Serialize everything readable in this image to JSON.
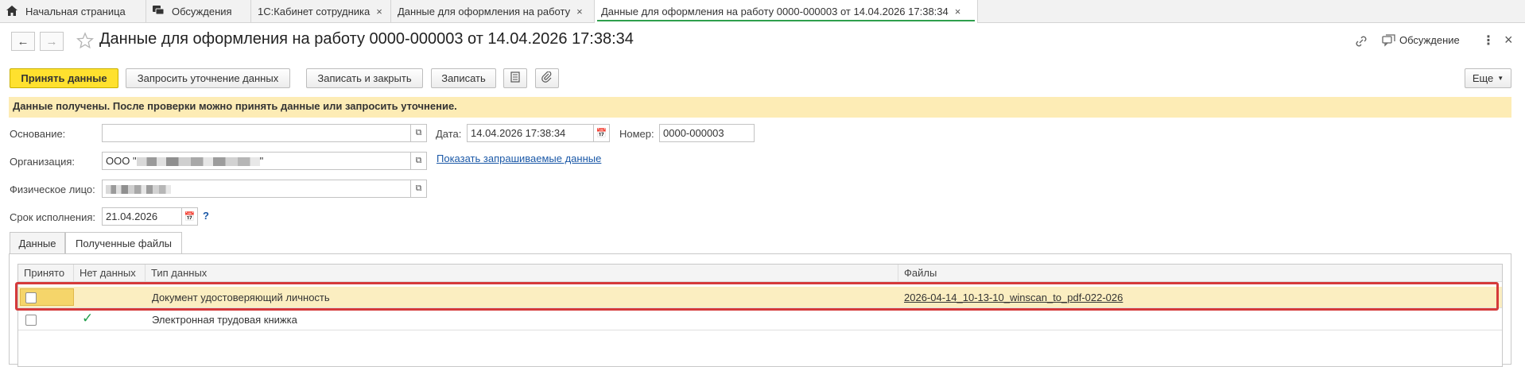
{
  "tabs": [
    {
      "label": "Начальная страница",
      "icon": "home-icon"
    },
    {
      "label": "Обсуждения",
      "icon": "chat-icon"
    },
    {
      "label": "1С:Кабинет сотрудника",
      "close": "×"
    },
    {
      "label": "Данные для оформления на работу",
      "close": "×"
    },
    {
      "label": "Данные для оформления на работу 0000-000003 от 14.04.2026 17:38:34",
      "close": "×"
    }
  ],
  "window": {
    "title": "Данные для оформления на работу 0000-000003 от 14.04.2026 17:38:34",
    "discussion_label": "Обсуждение"
  },
  "toolbar": {
    "accept": "Принять данные",
    "request": "Запросить уточнение данных",
    "save_close": "Записать и закрыть",
    "save": "Записать",
    "more": "Еще"
  },
  "info_message": "Данные получены. После проверки можно принять данные или запросить уточнение.",
  "form": {
    "basis_label": "Основание:",
    "basis_value": "",
    "date_label": "Дата:",
    "date_value": "14.04.2026 17:38:34",
    "number_label": "Номер:",
    "number_value": "0000-000003",
    "org_label": "Организация:",
    "org_prefix": "ООО \"",
    "org_suffix": "\"",
    "show_requested_link": "Показать запрашиваемые данные",
    "person_label": "Физическое лицо:",
    "deadline_label": "Срок исполнения:",
    "deadline_value": "21.04.2026",
    "help": "?"
  },
  "form_tabs": [
    "Данные",
    "Полученные файлы"
  ],
  "table": {
    "headers": [
      "Принято",
      "Нет данных",
      "Тип данных",
      "Файлы"
    ],
    "rows": [
      {
        "accepted": false,
        "no_data": false,
        "type": "Документ удостоверяющий личность",
        "file": "2026-04-14_10-13-10_winscan_to_pdf-022-026"
      },
      {
        "accepted": false,
        "no_data": true,
        "type": "Электронная трудовая книжка",
        "file": ""
      }
    ]
  },
  "colors": {
    "accent": "#ffe12e",
    "info": "#fdecb5",
    "active_tab_underline": "#2e9f4d",
    "highlight": "#d53a3a",
    "check": "#1f9e4a"
  }
}
